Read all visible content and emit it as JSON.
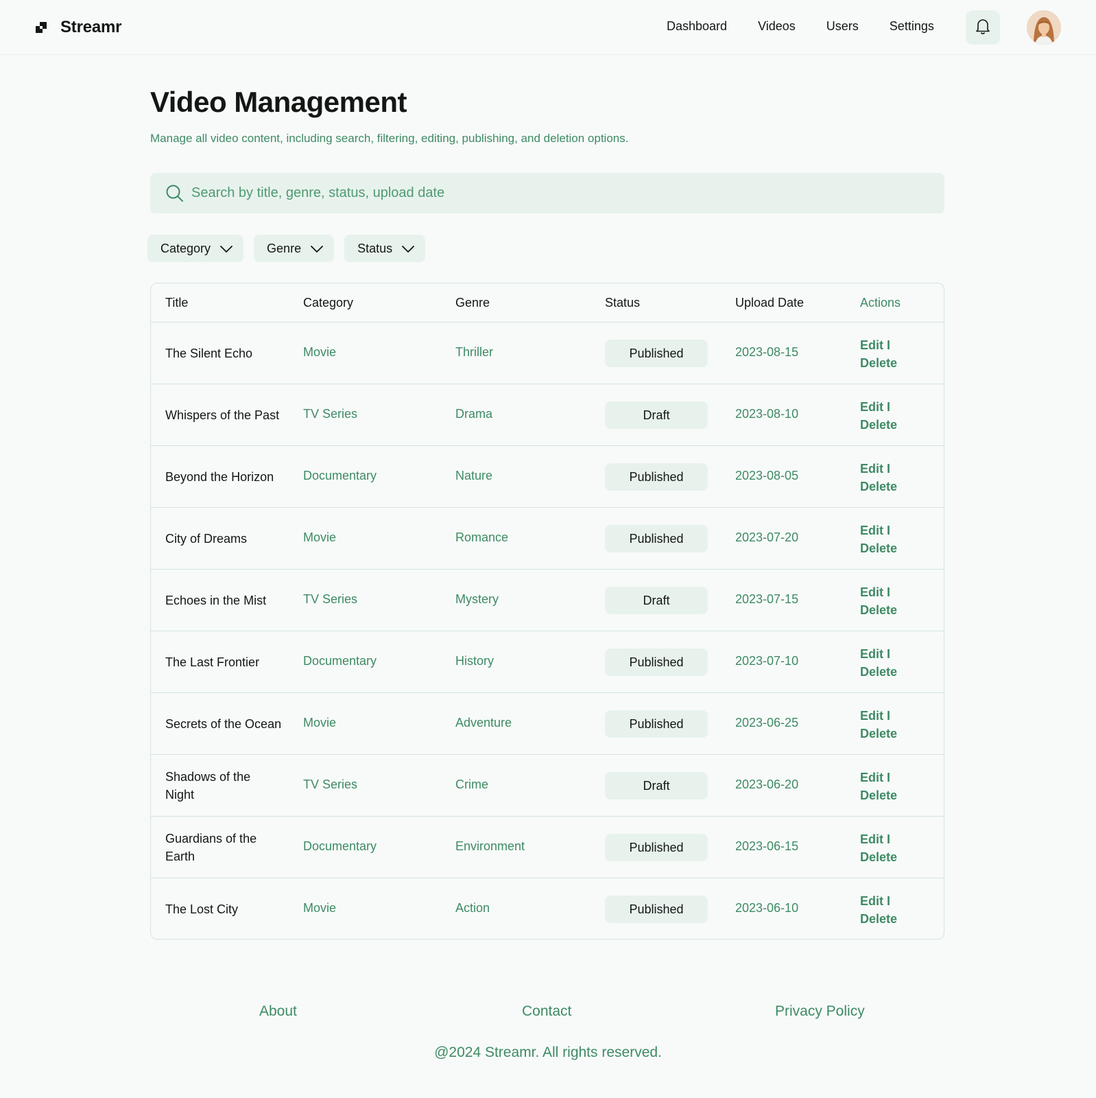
{
  "header": {
    "brand": "Streamr",
    "nav": [
      "Dashboard",
      "Videos",
      "Users",
      "Settings"
    ]
  },
  "page": {
    "title": "Video Management",
    "description": "Manage all video content, including search, filtering, editing, publishing, and deletion options."
  },
  "search": {
    "placeholder": "Search by title, genre, status, upload date",
    "value": ""
  },
  "filters": [
    "Category",
    "Genre",
    "Status"
  ],
  "table": {
    "columns": [
      "Title",
      "Category",
      "Genre",
      "Status",
      "Upload Date",
      "Actions"
    ],
    "rows": [
      {
        "title": "The Silent Echo",
        "category": "Movie",
        "genre": "Thriller",
        "status": "Published",
        "date": "2023-08-15",
        "edit": "Edit I",
        "delete": "Delete"
      },
      {
        "title": "Whispers of the Past",
        "category": "TV Series",
        "genre": "Drama",
        "status": "Draft",
        "date": "2023-08-10",
        "edit": "Edit I",
        "delete": "Delete"
      },
      {
        "title": "Beyond the Horizon",
        "category": "Documentary",
        "genre": "Nature",
        "status": "Published",
        "date": "2023-08-05",
        "edit": "Edit I",
        "delete": "Delete"
      },
      {
        "title": "City of Dreams",
        "category": "Movie",
        "genre": "Romance",
        "status": "Published",
        "date": "2023-07-20",
        "edit": "Edit I",
        "delete": "Delete"
      },
      {
        "title": "Echoes in the Mist",
        "category": "TV Series",
        "genre": "Mystery",
        "status": "Draft",
        "date": "2023-07-15",
        "edit": "Edit I",
        "delete": "Delete"
      },
      {
        "title": "The Last Frontier",
        "category": "Documentary",
        "genre": "History",
        "status": "Published",
        "date": "2023-07-10",
        "edit": "Edit I",
        "delete": "Delete"
      },
      {
        "title": "Secrets of the Ocean",
        "category": "Movie",
        "genre": "Adventure",
        "status": "Published",
        "date": "2023-06-25",
        "edit": "Edit I",
        "delete": "Delete"
      },
      {
        "title": "Shadows of the Night",
        "category": "TV Series",
        "genre": "Crime",
        "status": "Draft",
        "date": "2023-06-20",
        "edit": "Edit I",
        "delete": "Delete"
      },
      {
        "title": "Guardians of the Earth",
        "category": "Documentary",
        "genre": "Environment",
        "status": "Published",
        "date": "2023-06-15",
        "edit": "Edit I",
        "delete": "Delete"
      },
      {
        "title": "The Lost City",
        "category": "Movie",
        "genre": "Action",
        "status": "Published",
        "date": "2023-06-10",
        "edit": "Edit I",
        "delete": "Delete"
      }
    ]
  },
  "footer": {
    "links": [
      "About",
      "Contact",
      "Privacy Policy"
    ],
    "copyright": "@2024 Streamr. All rights reserved."
  },
  "icons": {
    "logo": "logo-icon",
    "notifications": "bell-icon",
    "search": "search-icon",
    "dropdown": "chevron-down-icon",
    "profile": "avatar"
  },
  "colors": {
    "accent": "#3f8a64",
    "chip_background": "#e8f2ed",
    "page_background": "#f7faf9",
    "border": "#d6e4dc",
    "text": "#121714"
  }
}
